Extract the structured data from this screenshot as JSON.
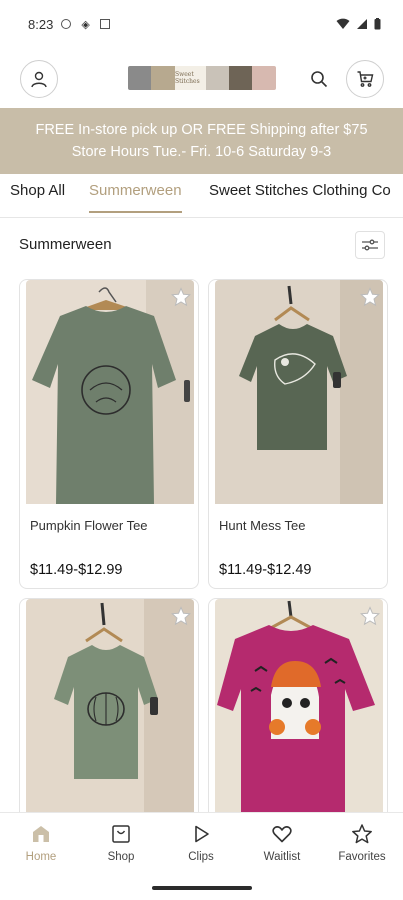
{
  "status_bar": {
    "time": "8:23"
  },
  "header": {
    "account_icon": "person-icon",
    "search_icon": "search-icon",
    "cart_icon": "cart-icon",
    "logo_text": "Sweet Stitches"
  },
  "banner": {
    "line1": "FREE In-store pick up OR FREE Shipping after $75",
    "line2": "Store Hours Tue.- Fri. 10-6 Saturday 9-3"
  },
  "tabs": [
    {
      "label": "Shop All"
    },
    {
      "label": "Summerween"
    },
    {
      "label": "Sweet Stitches Clothing Co"
    }
  ],
  "active_tab": "Summerween",
  "section": {
    "title": "Summerween",
    "filter_icon": "sliders-icon"
  },
  "products": [
    {
      "name": "Pumpkin Flower Tee",
      "price": "$11.49-$12.99",
      "shirt_color": "#6f7f6c"
    },
    {
      "name": "Hunt Mess Tee",
      "price": "$11.49-$12.49",
      "shirt_color": "#586653"
    },
    {
      "name": "",
      "price": "",
      "shirt_color": "#7d8f78"
    },
    {
      "name": "",
      "price": "",
      "shirt_color": "#b52a6e"
    }
  ],
  "bottom_nav": [
    {
      "label": "Home",
      "icon": "home-icon",
      "active": true
    },
    {
      "label": "Shop",
      "icon": "shop-icon"
    },
    {
      "label": "Clips",
      "icon": "play-icon"
    },
    {
      "label": "Waitlist",
      "icon": "heart-icon"
    },
    {
      "label": "Favorites",
      "icon": "star-icon"
    }
  ],
  "colors": {
    "accent": "#b29f7e",
    "banner_bg": "#c8bda8"
  }
}
